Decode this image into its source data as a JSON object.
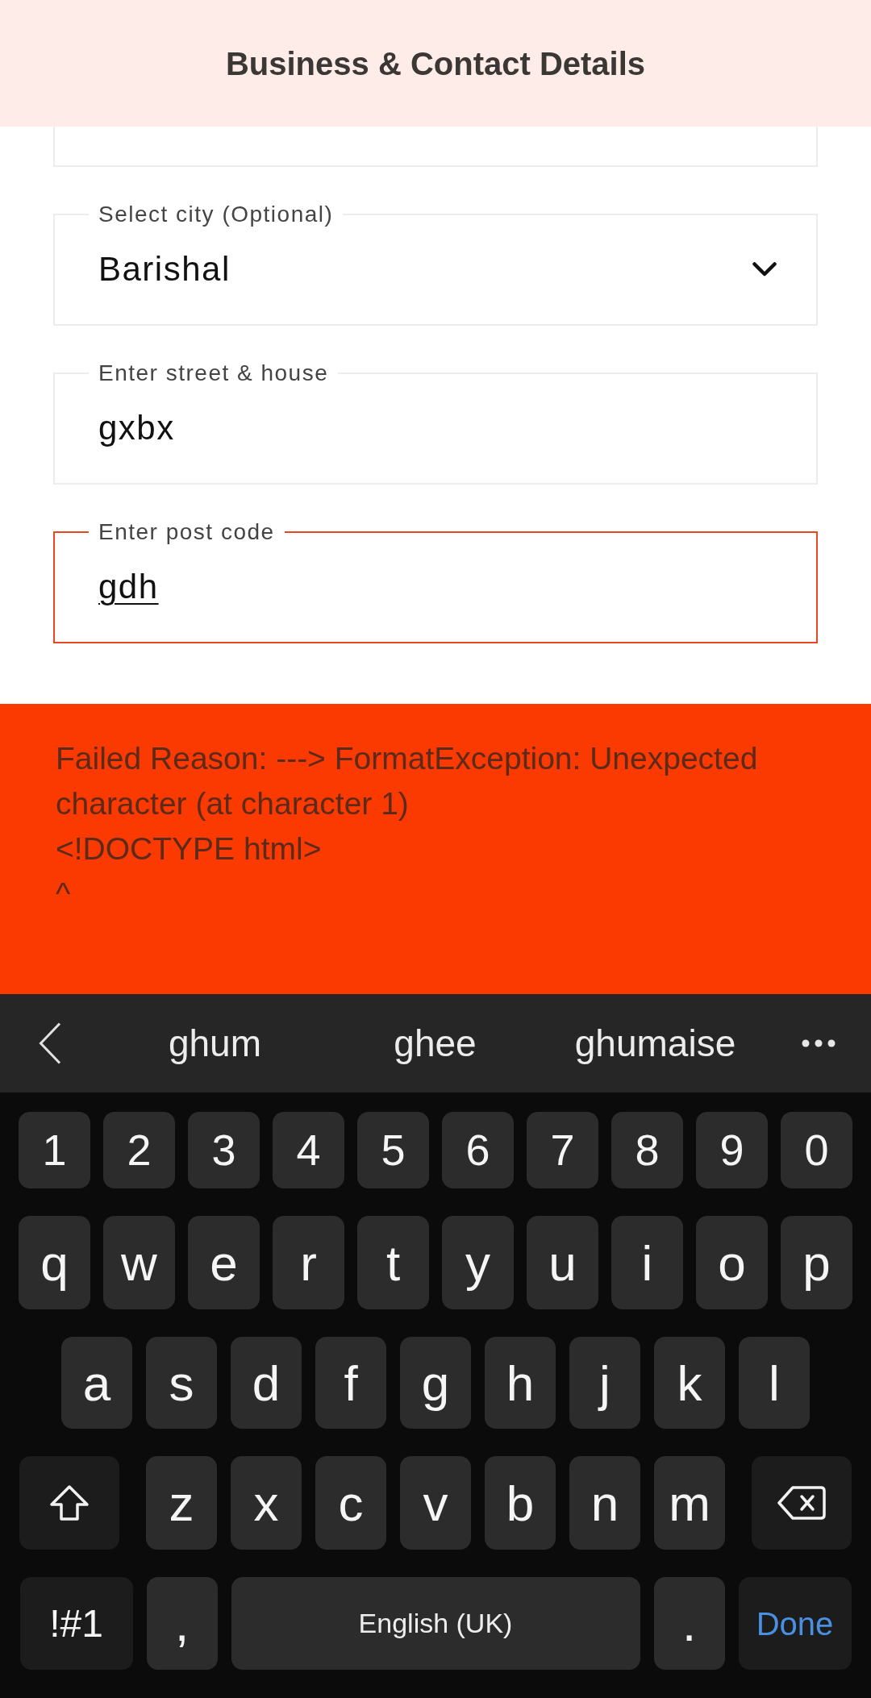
{
  "header": {
    "title": "Business & Contact Details"
  },
  "form": {
    "fields": [
      {
        "kind": "clipped",
        "focused": false
      },
      {
        "kind": "dropdown",
        "label": "Select city (Optional)",
        "value": "Barishal",
        "focused": false,
        "composing": false
      },
      {
        "kind": "text",
        "label": "Enter street & house",
        "value": "gxbx",
        "focused": false,
        "composing": false
      },
      {
        "kind": "text",
        "label": "Enter post code",
        "value": "gdh",
        "focused": true,
        "composing": true
      }
    ]
  },
  "error_banner": {
    "message": "Failed Reason: ---> FormatException: Unexpected character (at character 1)\n<!DOCTYPE html>\n^"
  },
  "keyboard": {
    "suggestions": [
      "ghum",
      "ghee",
      "ghumaise"
    ],
    "key_rows": [
      {
        "keys": [
          {
            "kind": "char",
            "label": "1"
          },
          {
            "kind": "char",
            "label": "2"
          },
          {
            "kind": "char",
            "label": "3"
          },
          {
            "kind": "char",
            "label": "4"
          },
          {
            "kind": "char",
            "label": "5"
          },
          {
            "kind": "char",
            "label": "6"
          },
          {
            "kind": "char",
            "label": "7"
          },
          {
            "kind": "char",
            "label": "8"
          },
          {
            "kind": "char",
            "label": "9"
          },
          {
            "kind": "char",
            "label": "0"
          }
        ]
      },
      {
        "keys": [
          {
            "kind": "char",
            "label": "q"
          },
          {
            "kind": "char",
            "label": "w"
          },
          {
            "kind": "char",
            "label": "e"
          },
          {
            "kind": "char",
            "label": "r"
          },
          {
            "kind": "char",
            "label": "t"
          },
          {
            "kind": "char",
            "label": "y"
          },
          {
            "kind": "char",
            "label": "u"
          },
          {
            "kind": "char",
            "label": "i"
          },
          {
            "kind": "char",
            "label": "o"
          },
          {
            "kind": "char",
            "label": "p"
          }
        ]
      },
      {
        "keys": [
          {
            "kind": "char",
            "label": "a"
          },
          {
            "kind": "char",
            "label": "s"
          },
          {
            "kind": "char",
            "label": "d"
          },
          {
            "kind": "char",
            "label": "f"
          },
          {
            "kind": "char",
            "label": "g"
          },
          {
            "kind": "char",
            "label": "h"
          },
          {
            "kind": "char",
            "label": "j"
          },
          {
            "kind": "char",
            "label": "k"
          },
          {
            "kind": "char",
            "label": "l"
          }
        ]
      },
      {
        "keys": [
          {
            "kind": "shift"
          },
          {
            "kind": "char",
            "label": "z"
          },
          {
            "kind": "char",
            "label": "x"
          },
          {
            "kind": "char",
            "label": "c"
          },
          {
            "kind": "char",
            "label": "v"
          },
          {
            "kind": "char",
            "label": "b"
          },
          {
            "kind": "char",
            "label": "n"
          },
          {
            "kind": "char",
            "label": "m"
          },
          {
            "kind": "backspace"
          }
        ]
      },
      {
        "keys": [
          {
            "kind": "symbols",
            "label": "!#1"
          },
          {
            "kind": "char",
            "label": ","
          },
          {
            "kind": "space",
            "label": "English (UK)"
          },
          {
            "kind": "char",
            "label": "."
          },
          {
            "kind": "done",
            "label": "Done"
          }
        ]
      }
    ]
  }
}
